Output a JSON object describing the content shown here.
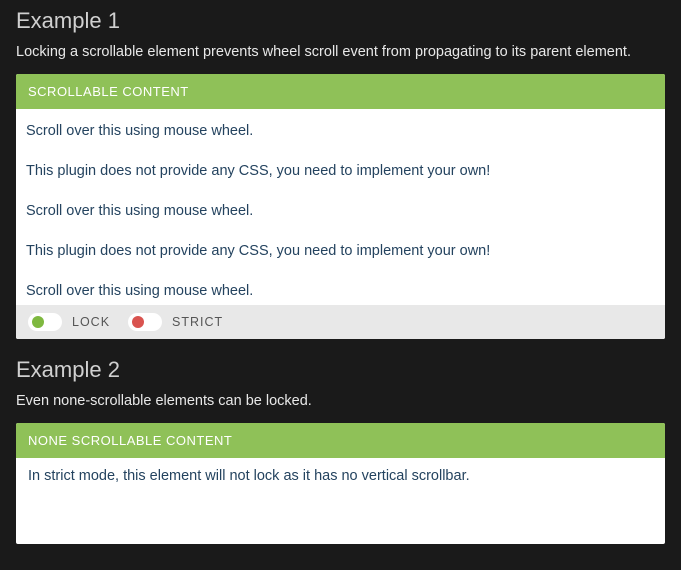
{
  "example1": {
    "heading": "Example 1",
    "desc": "Locking a scrollable element prevents wheel scroll event from propagating to its parent element.",
    "panelTitle": "SCROLLABLE CONTENT",
    "lines": [
      "Scroll over this using mouse wheel.",
      "This plugin does not provide any CSS, you need to implement your own!",
      "Scroll over this using mouse wheel.",
      "This plugin does not provide any CSS, you need to implement your own!",
      "Scroll over this using mouse wheel."
    ],
    "lockLabel": "LOCK",
    "strictLabel": "STRICT"
  },
  "example2": {
    "heading": "Example 2",
    "desc": "Even none-scrollable elements can be locked.",
    "panelTitle": "NONE SCROLLABLE CONTENT",
    "body": "In strict mode, this element will not lock as it has no vertical scrollbar."
  }
}
